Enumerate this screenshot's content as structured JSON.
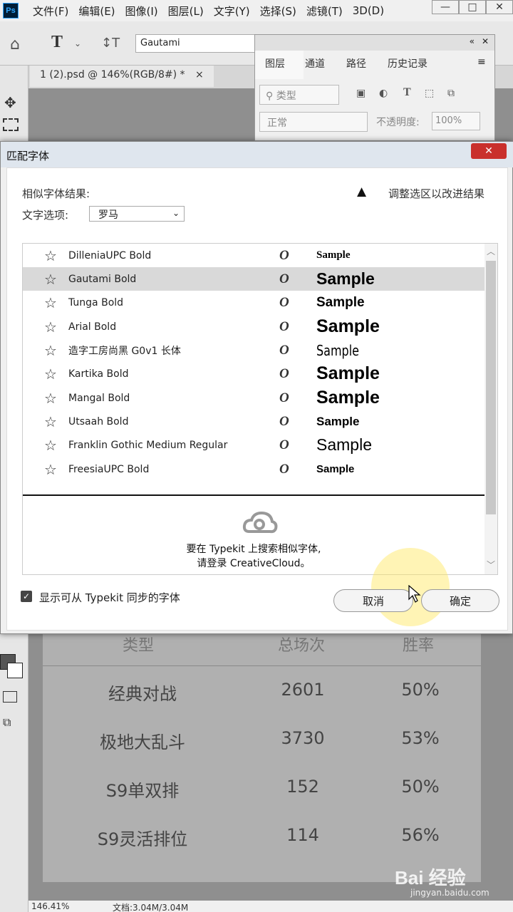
{
  "menubar": {
    "logo": "Ps",
    "items": [
      "文件(F)",
      "编辑(E)",
      "图像(I)",
      "图层(L)",
      "文字(Y)",
      "选择(S)",
      "滤镜(T)",
      "3D(D)"
    ],
    "window_buttons": [
      "—",
      "□",
      "✕"
    ]
  },
  "options": {
    "font_value": "Gautami"
  },
  "document": {
    "tab_label": "1 (2).psd @ 146%(RGB/8#) *",
    "tab_close": "×"
  },
  "layers_panel": {
    "tabs": [
      "图层",
      "通道",
      "路径",
      "历史记录"
    ],
    "filter_label": "类型",
    "blend_mode": "正常",
    "opacity_label": "不透明度:",
    "opacity_value": "100%",
    "icons": [
      "image-icon",
      "adjust-icon",
      "type-icon",
      "shape-icon",
      "smart-object-icon"
    ]
  },
  "dialog": {
    "title": "匹配字体",
    "results_label": "相似字体结果:",
    "hint": "调整选区以改进结果",
    "option_label": "文字选项:",
    "option_value": "罗马",
    "fonts": [
      {
        "name": "DilleniaUPC Bold",
        "type_icon": "O",
        "sample": "Sample"
      },
      {
        "name": "Gautami Bold",
        "type_icon": "O",
        "sample": "Sample",
        "selected": true
      },
      {
        "name": "Tunga Bold",
        "type_icon": "O",
        "sample": "Sample"
      },
      {
        "name": "Arial Bold",
        "type_icon": "O",
        "sample": "Sample"
      },
      {
        "name": "造字工房尚黑 G0v1 长体",
        "type_icon": "O",
        "sample": "Sample"
      },
      {
        "name": "Kartika Bold",
        "type_icon": "O",
        "sample": "Sample"
      },
      {
        "name": "Mangal Bold",
        "type_icon": "O",
        "sample": "Sample"
      },
      {
        "name": "Utsaah Bold",
        "type_icon": "O",
        "sample": "Sample"
      },
      {
        "name": "Franklin Gothic Medium Regular",
        "type_icon": "O",
        "sample": "Sample"
      },
      {
        "name": "FreesiaUPC Bold",
        "type_icon": "O",
        "sample": "Sample"
      }
    ],
    "typekit_line1": "要在 Typekit 上搜索相似字体,",
    "typekit_line2": "请登录 CreativeCloud。",
    "checkbox_label": "显示可从 Typekit 同步的字体",
    "cancel": "取消",
    "ok": "确定"
  },
  "table": {
    "headers": [
      "类型",
      "总场次",
      "胜率"
    ],
    "rows": [
      [
        "经典对战",
        "2601",
        "50%"
      ],
      [
        "极地大乱斗",
        "3730",
        "53%"
      ],
      [
        "S9单双排",
        "152",
        "50%"
      ],
      [
        "S9灵活排位",
        "114",
        "56%"
      ]
    ]
  },
  "status": {
    "zoom": "146.41%",
    "doc": "文档:3.04M/3.04M"
  },
  "watermark": {
    "brand": "Bai 经验",
    "url": "jingyan.baidu.com"
  }
}
